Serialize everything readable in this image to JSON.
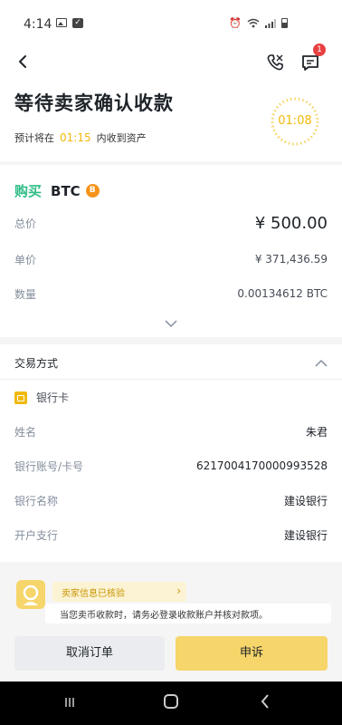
{
  "status_bar": {
    "time": "4:14"
  },
  "nav": {
    "chat_badge": "1"
  },
  "header": {
    "title": "等待卖家确认收款",
    "sub_prefix": "预计将在",
    "sub_time": "01:15",
    "sub_suffix": "内收到资产",
    "timer": "01:08"
  },
  "order": {
    "side": "购买",
    "coin": "BTC",
    "coin_icon": "B",
    "rows": [
      {
        "label": "总价",
        "value": "¥ 500.00"
      },
      {
        "label": "单价",
        "value": "¥ 371,436.59"
      },
      {
        "label": "数量",
        "value": "0.00134612 BTC"
      }
    ]
  },
  "payment": {
    "title": "交易方式",
    "method": "银行卡",
    "rows": [
      {
        "label": "姓名",
        "value": "朱君"
      },
      {
        "label": "银行账号/卡号",
        "value": "6217004170000993528"
      },
      {
        "label": "银行名称",
        "value": "建设银行"
      },
      {
        "label": "开户支行",
        "value": "建设银行"
      }
    ]
  },
  "notice": {
    "tag": "卖家信息已核验",
    "message": "当您卖币收款时，请务必登录收款账户并核对款项。"
  },
  "actions": {
    "cancel": "取消订单",
    "appeal": "申诉"
  },
  "colors": {
    "accent": "#f0b90b",
    "buy": "#2ebd85",
    "btc": "#f7931a",
    "badge": "#e84142"
  }
}
